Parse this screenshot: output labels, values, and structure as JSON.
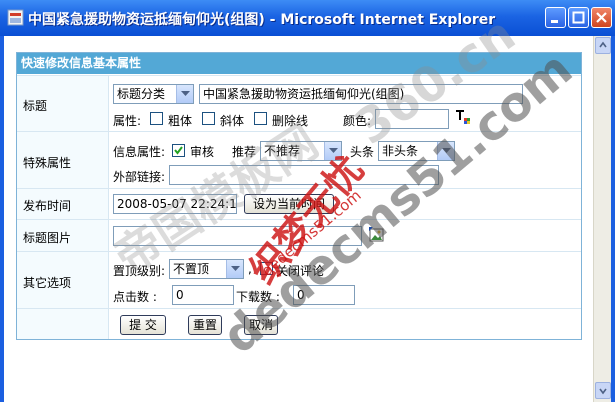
{
  "window": {
    "title": "中国紧急援助物资运抵缅甸仰光(组图) - Microsoft Internet Explorer"
  },
  "panel": {
    "header": "快速修改信息基本属性"
  },
  "title_row": {
    "label": "标题",
    "category_select": "标题分类",
    "title_value": "中国紧急援助物资运抵缅甸仰光(组图)",
    "attr_label": "属性:",
    "bold_label": "粗体",
    "italic_label": "斜体",
    "strike_label": "删除线",
    "color_label": "颜色:",
    "color_value": ""
  },
  "special_row": {
    "label": "特殊属性",
    "info_attr_label": "信息属性:",
    "audit_label": "审核",
    "audit_checked": true,
    "recommend_label": "推荐",
    "recommend_select": "不推荐",
    "headline_label": "头条",
    "headline_select": "非头条",
    "external_link_label": "外部链接:",
    "external_link_value": ""
  },
  "publish_row": {
    "label": "发布时间",
    "datetime_value": "2008-05-07 22:24:11",
    "set_now_button": "设为当前时间"
  },
  "image_row": {
    "label": "标题图片",
    "image_value": ""
  },
  "other_row": {
    "label": "其它选项",
    "top_level_label": "置顶级别:",
    "top_level_select": "不置顶",
    "comma": ",",
    "close_comment_label": "关闭评论",
    "clicks_label": "点击数 :",
    "clicks_value": "0",
    "downloads_label": "下载数 :",
    "downloads_value": "0"
  },
  "actions": {
    "submit": "提 交",
    "reset": "重置",
    "cancel": "取消"
  },
  "watermarks": {
    "w1": "帝国模板网",
    "w2": "dedecms51.com",
    "w3": "织梦无忧",
    "w4": "dedecms51.com",
    "w5": "360.cn"
  },
  "colors": {
    "titlebar": "#1b64e3",
    "panel_header": "#53a8d6",
    "panel_border": "#7fb3d8"
  }
}
